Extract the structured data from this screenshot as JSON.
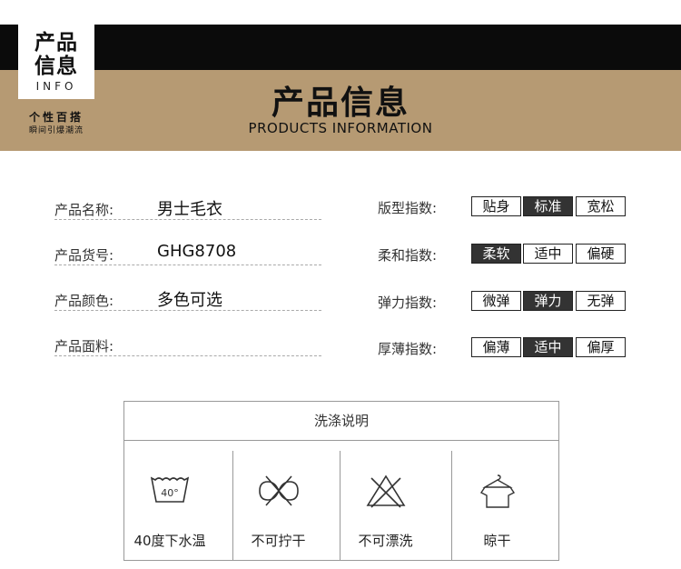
{
  "banner": {
    "logo_line1": "产品",
    "logo_line2": "信息",
    "logo_en": "INFO",
    "slogan_main": "个性百搭",
    "slogan_sub": "瞬间引爆潮流",
    "title": "产品信息",
    "subtitle": "PRODUCTS INFORMATION"
  },
  "product_info": [
    {
      "label": "产品名称:",
      "value": "男士毛衣"
    },
    {
      "label": "产品货号:",
      "value": "GHG8708"
    },
    {
      "label": "产品颜色:",
      "value": "多色可选"
    },
    {
      "label": "产品面料:",
      "value": ""
    }
  ],
  "indices": [
    {
      "label": "版型指数:",
      "options": [
        "贴身",
        "标准",
        "宽松"
      ],
      "selected": 1
    },
    {
      "label": "柔和指数:",
      "options": [
        "柔软",
        "适中",
        "偏硬"
      ],
      "selected": 0
    },
    {
      "label": "弹力指数:",
      "options": [
        "微弹",
        "弹力",
        "无弹"
      ],
      "selected": 1
    },
    {
      "label": "厚薄指数:",
      "options": [
        "偏薄",
        "适中",
        "偏厚"
      ],
      "selected": 1
    }
  ],
  "washing": {
    "title": "洗涤说明",
    "items": [
      {
        "icon": "wash-40-icon",
        "label": "40度下水温",
        "temp": "40°"
      },
      {
        "icon": "no-wring-icon",
        "label": "不可拧干"
      },
      {
        "icon": "no-bleach-icon",
        "label": "不可漂洗"
      },
      {
        "icon": "hang-dry-icon",
        "label": "晾干"
      }
    ]
  }
}
